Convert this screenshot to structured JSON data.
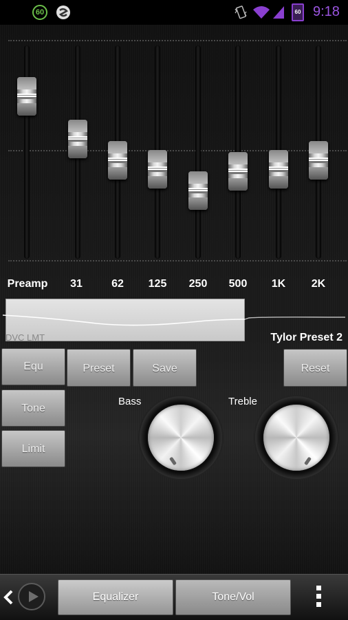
{
  "status_bar": {
    "badge_60": "60",
    "battery_label": "60",
    "time": "9:18"
  },
  "equalizer": {
    "bands": [
      {
        "label": "Preamp",
        "level": 0.76
      },
      {
        "label": "31",
        "level": 0.56
      },
      {
        "label": "62",
        "level": 0.46
      },
      {
        "label": "125",
        "level": 0.42
      },
      {
        "label": "250",
        "level": 0.32
      },
      {
        "label": "500",
        "level": 0.41
      },
      {
        "label": "1K",
        "level": 0.42
      },
      {
        "label": "2K",
        "level": 0.46
      }
    ],
    "display_label": "DVC LMT",
    "preset_name": "Tylor Preset 2"
  },
  "buttons": {
    "equ": "Equ",
    "preset": "Preset",
    "save": "Save",
    "reset": "Reset",
    "tone": "Tone",
    "limit": "Limit"
  },
  "knobs": {
    "bass_label": "Bass",
    "treble_label": "Treble"
  },
  "bottom_bar": {
    "tab_equalizer": "Equalizer",
    "tab_tonevol": "Tone/Vol"
  },
  "colors": {
    "accent_purple": "#9b55e0",
    "status_green": "#6cc04a"
  },
  "icons": [
    "badge-60-icon",
    "snap-icon",
    "vibrate-icon",
    "wifi-icon",
    "signal-icon",
    "battery-icon",
    "chevron-left-icon",
    "play-icon",
    "overflow-menu-icon"
  ]
}
